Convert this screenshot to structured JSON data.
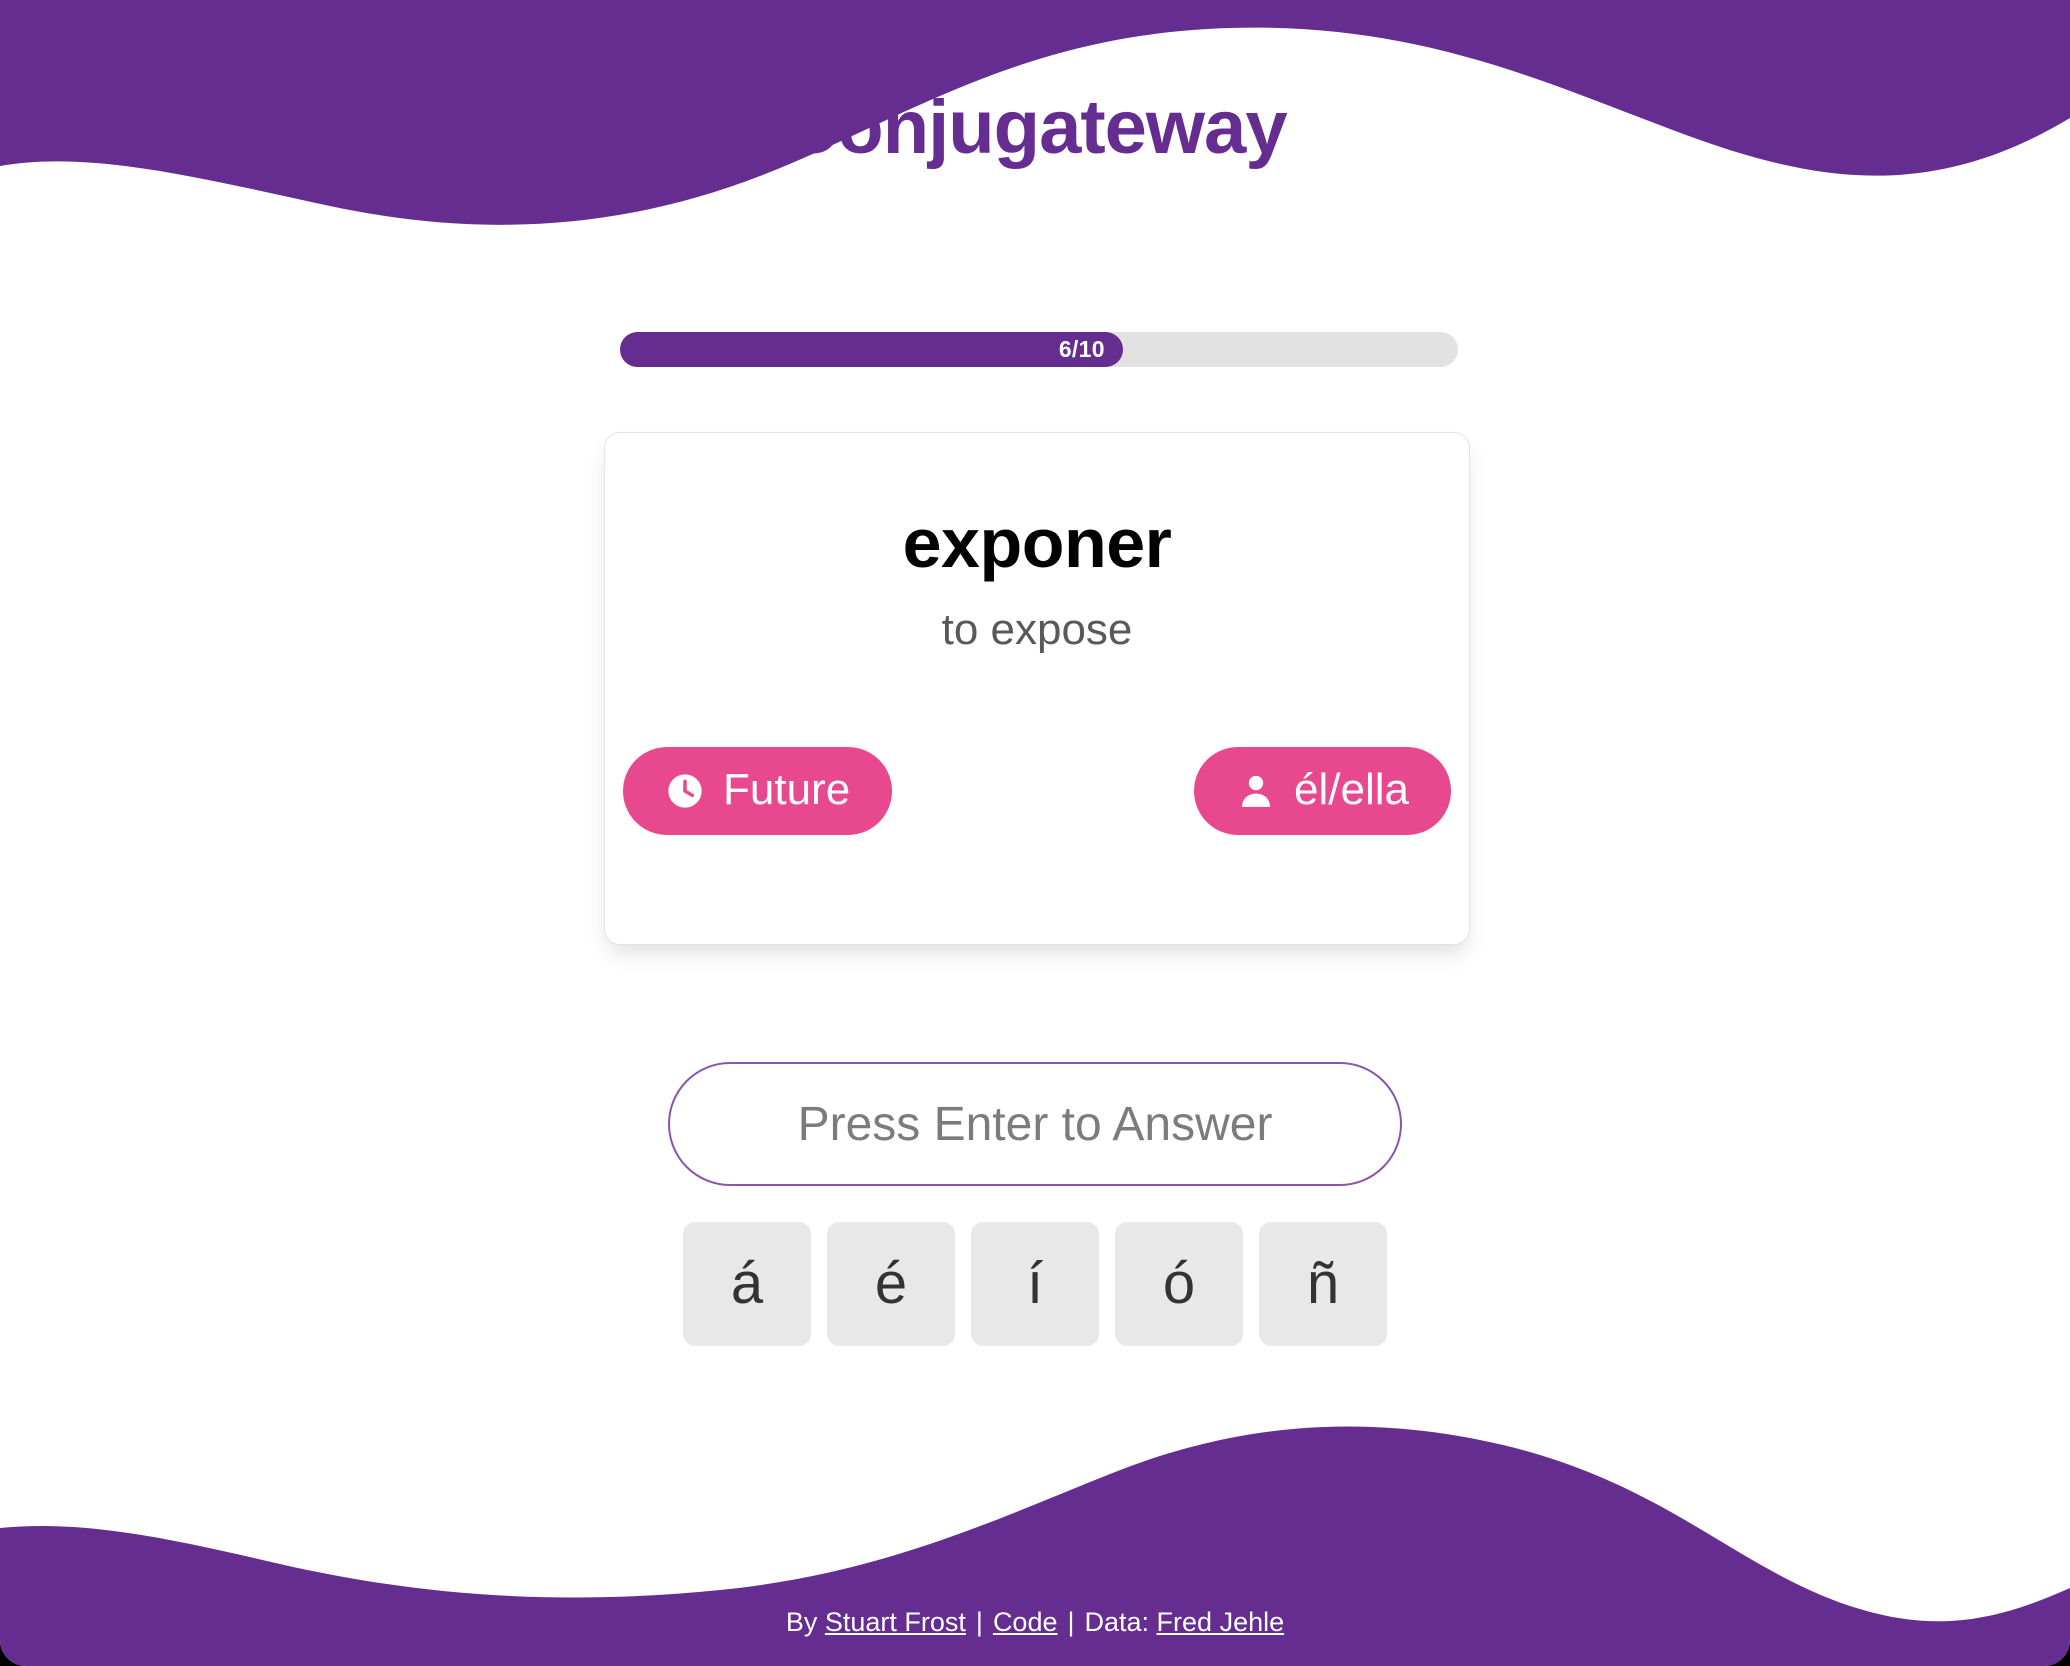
{
  "header": {
    "title": "Conjugateway"
  },
  "progress": {
    "label": "6/10",
    "current": 6,
    "total": 10,
    "percent": 60,
    "fill_color": "#662D91",
    "track_color": "#e2e2e2"
  },
  "card": {
    "verb": "exponer",
    "translation": "to expose",
    "tense_pill": {
      "label": "Future",
      "icon": "clock-icon",
      "color": "#E8488E"
    },
    "person_pill": {
      "label": "él/ella",
      "icon": "person-icon",
      "color": "#E8488E"
    }
  },
  "answer": {
    "value": "",
    "placeholder": "Press Enter to Answer",
    "border_color": "#8a55aa"
  },
  "accent_keys": [
    {
      "label": "á"
    },
    {
      "label": "é"
    },
    {
      "label": "í"
    },
    {
      "label": "ó"
    },
    {
      "label": "ñ"
    }
  ],
  "footer": {
    "by_prefix": "By ",
    "author": "Stuart Frost",
    "separator_1": "|",
    "code_link": "Code",
    "separator_2": "|",
    "data_prefix": "Data: ",
    "data_source": "Fred Jehle"
  },
  "theme": {
    "purple": "#662D91",
    "pink": "#E8488E",
    "background": "#ffffff"
  }
}
